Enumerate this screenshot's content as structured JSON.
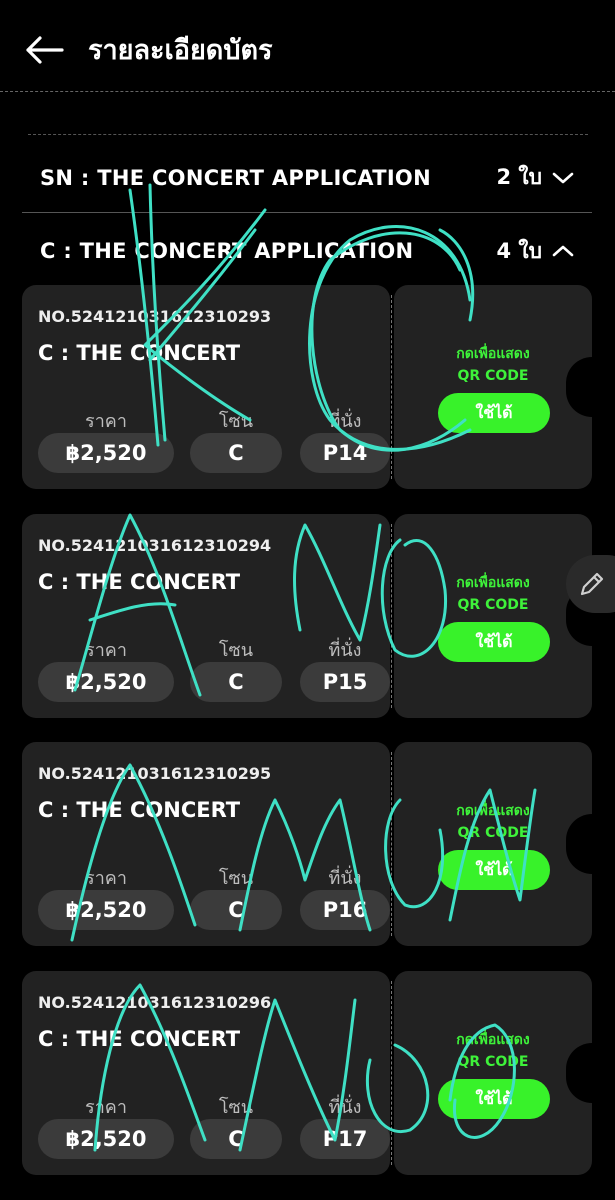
{
  "header": {
    "title": "รายละเอียดบัตร",
    "back_icon": "arrow-left-icon"
  },
  "groups": [
    {
      "title": "SN : THE CONCERT APPLICATION",
      "count": "2 ใบ",
      "expanded": false
    },
    {
      "title": "C : THE CONCERT APPLICATION",
      "count": "4 ใบ",
      "expanded": true
    }
  ],
  "labels": {
    "price": "ราคา",
    "zone": "โซน",
    "seat": "ที่นั่ง"
  },
  "stub": {
    "line1": "กดเพื่อแสดง",
    "line2": "QR CODE",
    "button": "ใช้ได้"
  },
  "tickets": [
    {
      "number": "NO.524121031612310293",
      "name": "C : THE CONCERT",
      "price": "฿2,520",
      "zone": "C",
      "seat": "P14"
    },
    {
      "number": "NO.524121031612310294",
      "name": "C : THE CONCERT",
      "price": "฿2,520",
      "zone": "C",
      "seat": "P15"
    },
    {
      "number": "NO.524121031612310295",
      "name": "C : THE CONCERT",
      "price": "฿2,520",
      "zone": "C",
      "seat": "P16"
    },
    {
      "number": "NO.524121031612310296",
      "name": "C : THE CONCERT",
      "price": "฿2,520",
      "zone": "C",
      "seat": "P17"
    }
  ],
  "colors": {
    "accent_green": "#38f22a",
    "scribble": "#3fe0c5",
    "card_bg": "#222222"
  },
  "fab_icon": "pencil-icon"
}
